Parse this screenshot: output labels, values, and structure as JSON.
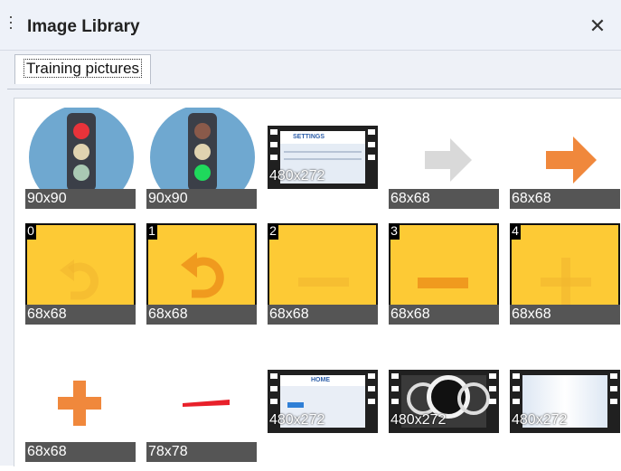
{
  "window": {
    "title": "Image Library",
    "close_symbol": "✕"
  },
  "tabs": [
    {
      "label": "Training pictures",
      "active": true
    }
  ],
  "images": [
    {
      "size": "90x90",
      "icon": "traffic-light-red-icon"
    },
    {
      "size": "90x90",
      "icon": "traffic-light-green-icon"
    },
    {
      "size": "480x272",
      "icon": "settings-screen-thumbnail",
      "screen_title": "SETTINGS"
    },
    {
      "size": "68x68",
      "icon": "arrow-right-gray-icon"
    },
    {
      "size": "68x68",
      "icon": "arrow-right-orange-icon"
    },
    {
      "size": "68x68",
      "index": "0",
      "icon": "undo-faded-icon"
    },
    {
      "size": "68x68",
      "index": "1",
      "icon": "undo-icon"
    },
    {
      "size": "68x68",
      "index": "2",
      "icon": "minus-faded-icon"
    },
    {
      "size": "68x68",
      "index": "3",
      "icon": "minus-icon"
    },
    {
      "size": "68x68",
      "index": "4",
      "icon": "plus-faded-icon"
    },
    {
      "size": "68x68",
      "icon": "plus-orange-icon"
    },
    {
      "size": "78x78",
      "icon": "red-line-icon"
    },
    {
      "size": "480x272",
      "icon": "home-screen-thumbnail",
      "screen_title": "HOME"
    },
    {
      "size": "480x272",
      "icon": "gauges-screen-thumbnail"
    },
    {
      "size": "480x272",
      "icon": "blank-screen-thumbnail"
    }
  ],
  "colors": {
    "accent_yellow": "#fdca35",
    "accent_orange": "#f0883c",
    "label_bg": "#555555"
  }
}
